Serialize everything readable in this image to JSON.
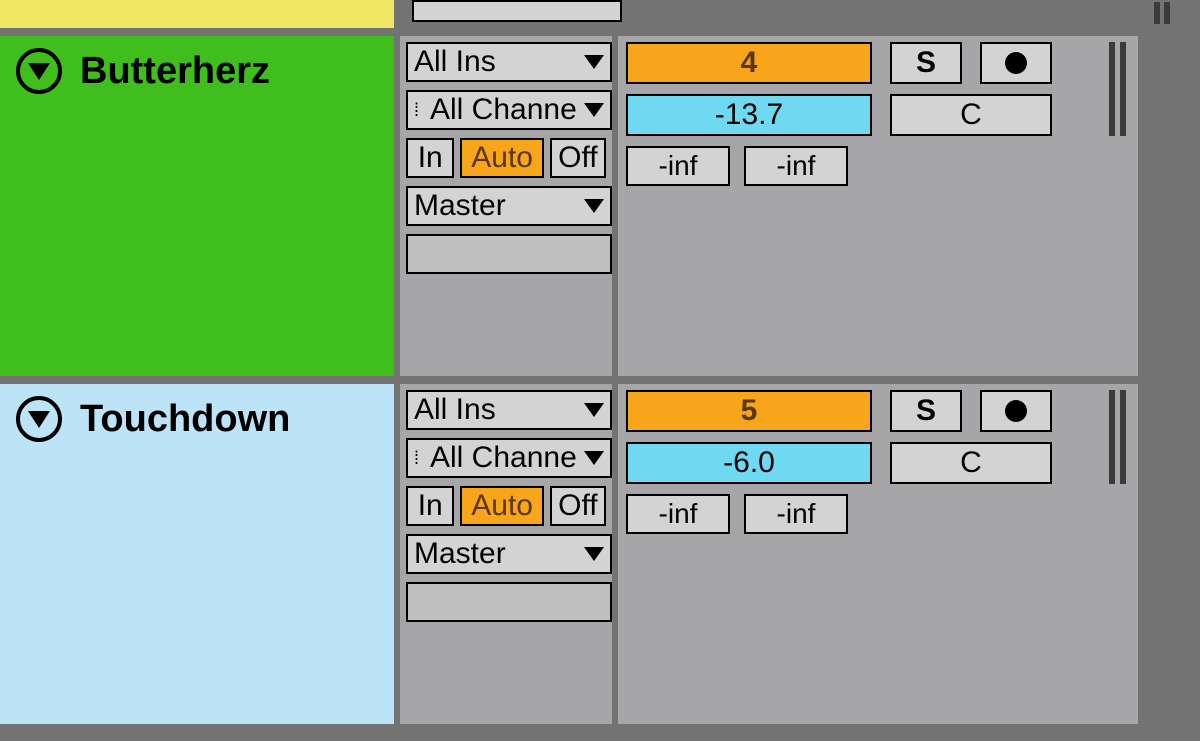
{
  "tracks": [
    {
      "name": "Butterherz",
      "color": "green",
      "input": "All Ins",
      "channel": "All Channe",
      "monitor": {
        "in": "In",
        "auto": "Auto",
        "off": "Off"
      },
      "output": "Master",
      "number": "4",
      "solo": "S",
      "volume": "-13.7",
      "pan": "C",
      "sendA": "-inf",
      "sendB": "-inf"
    },
    {
      "name": "Touchdown",
      "color": "lblue",
      "input": "All Ins",
      "channel": "All Channe",
      "monitor": {
        "in": "In",
        "auto": "Auto",
        "off": "Off"
      },
      "output": "Master",
      "number": "5",
      "solo": "S",
      "volume": "-6.0",
      "pan": "C",
      "sendA": "-inf",
      "sendB": "-inf"
    }
  ]
}
